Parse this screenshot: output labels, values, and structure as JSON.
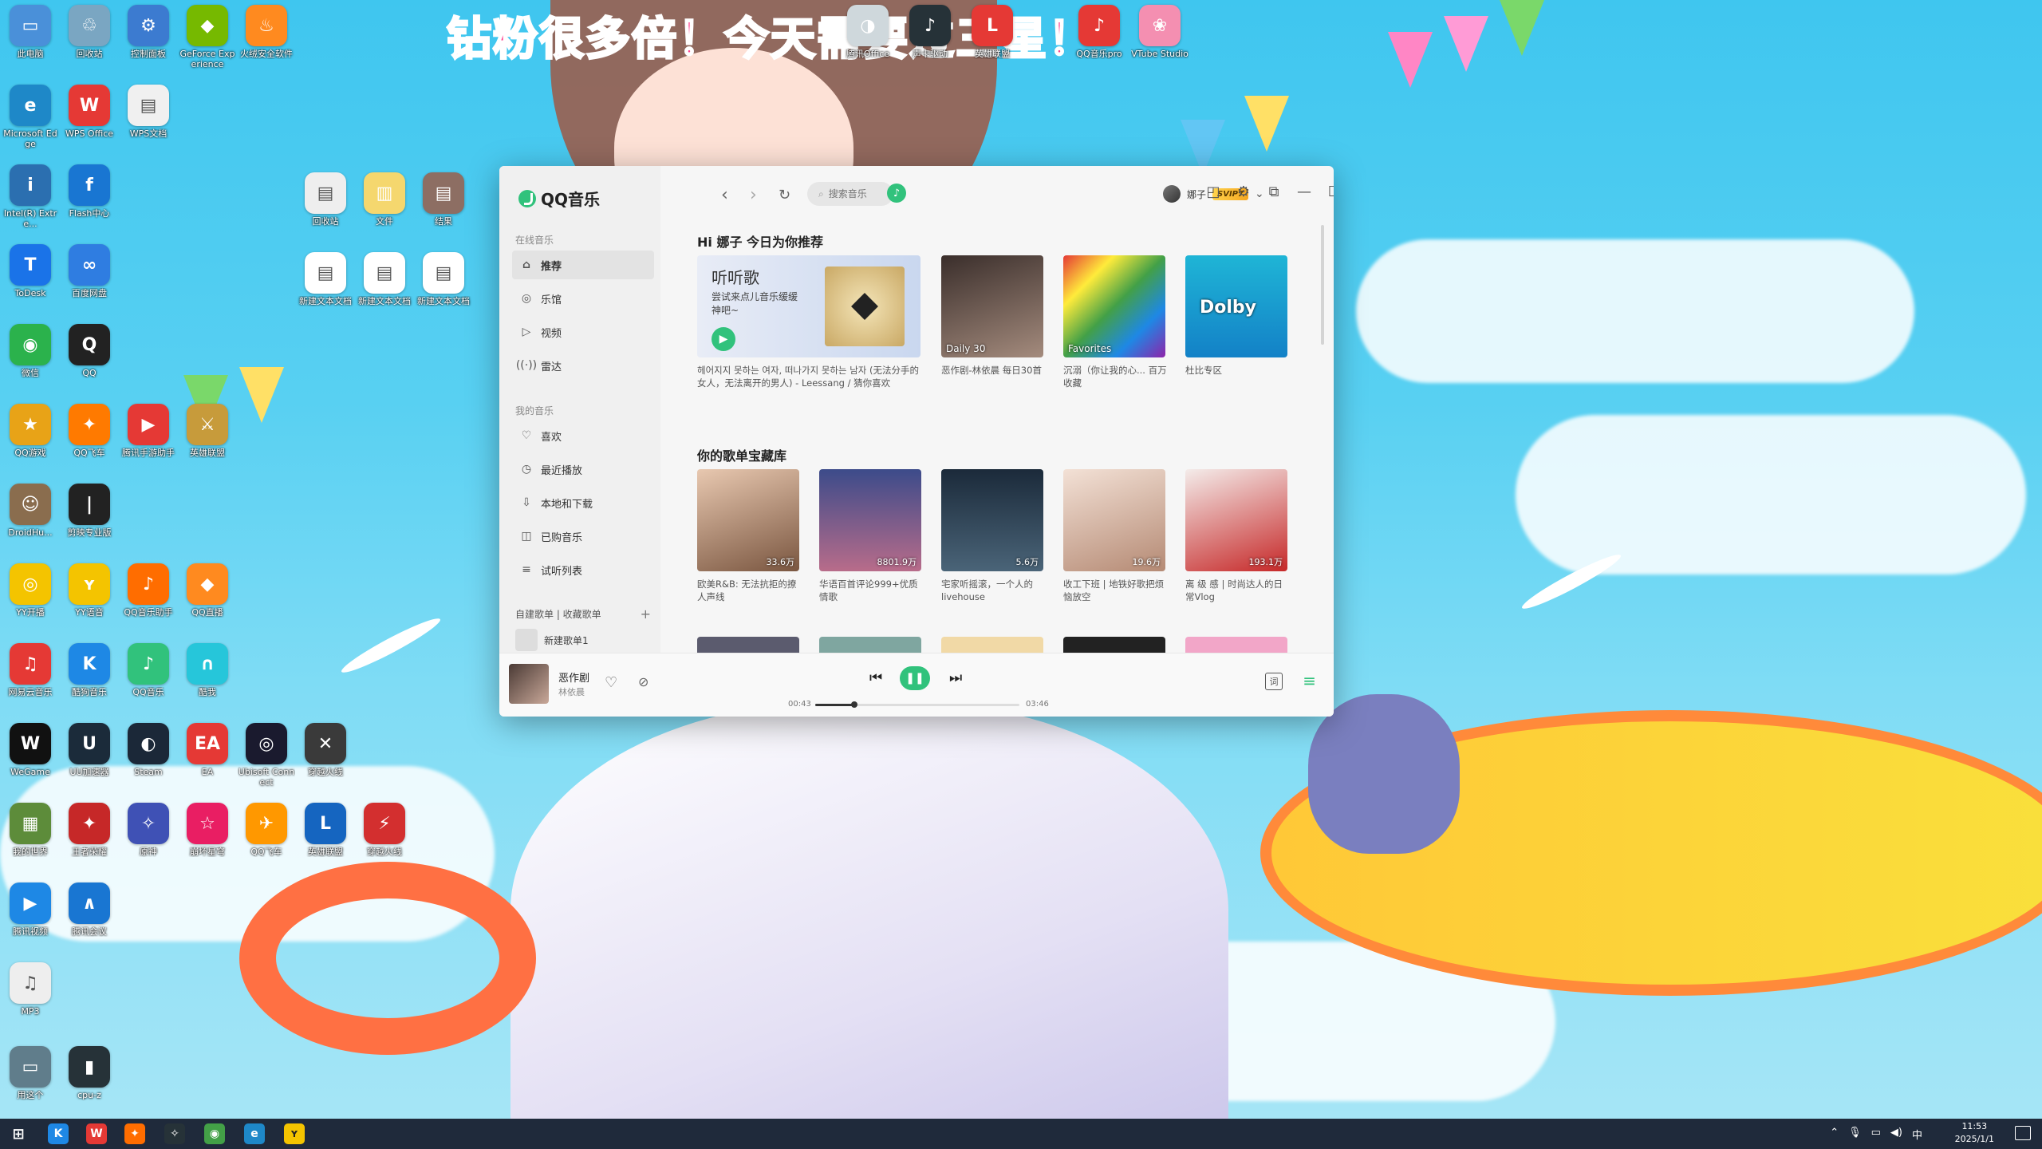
{
  "wallpaper": {
    "banner": "钻粉很多倍！今天需要过三星！"
  },
  "desktop_icons": [
    {
      "label": "此电脑",
      "color": "#4a90d9",
      "glyph": "▭"
    },
    {
      "label": "回收站",
      "color": "#7aa6c2",
      "glyph": "♲"
    },
    {
      "label": "控制面板",
      "color": "#3c7bd0",
      "glyph": "⚙"
    },
    {
      "label": "GeForce Experience",
      "color": "#76b900",
      "glyph": "◆"
    },
    {
      "label": "火绒安全软件",
      "color": "#ff8a1f",
      "glyph": "♨"
    },
    {
      "label": "Microsoft Edge",
      "color": "#1e88c8",
      "glyph": "e"
    },
    {
      "label": "WPS Office",
      "color": "#e53935",
      "glyph": "W"
    },
    {
      "label": "WPS文档",
      "color": "#f0f0f0",
      "glyph": "▤"
    },
    {
      "label": "Intel(R) Extre...",
      "color": "#2b6fb0",
      "glyph": "i"
    },
    {
      "label": "Flash中心",
      "color": "#1976d2",
      "glyph": "f"
    },
    {
      "label": "ToDesk",
      "color": "#1a73e8",
      "glyph": "T"
    },
    {
      "label": "百度网盘",
      "color": "#2f7de1",
      "glyph": "∞"
    },
    {
      "label": "微信",
      "color": "#2bb24c",
      "glyph": "◉"
    },
    {
      "label": "QQ",
      "color": "#222222",
      "glyph": "Q"
    },
    {
      "label": "QQ游戏",
      "color": "#e8a317",
      "glyph": "★"
    },
    {
      "label": "QQ飞车",
      "color": "#ff7a00",
      "glyph": "✦"
    },
    {
      "label": "腾讯手游助手",
      "color": "#e53935",
      "glyph": "▶"
    },
    {
      "label": "英雄联盟",
      "color": "#c79b3b",
      "glyph": "⚔"
    },
    {
      "label": "DroidHu...",
      "color": "#8a6d4e",
      "glyph": "☺"
    },
    {
      "label": "剪映专业版",
      "color": "#222222",
      "glyph": "|"
    },
    {
      "label": "YY开播",
      "color": "#f4c400",
      "glyph": "◎"
    },
    {
      "label": "YY语音",
      "color": "#f4c400",
      "glyph": "ʏ"
    },
    {
      "label": "QQ音乐助手",
      "color": "#ff6d00",
      "glyph": "♪"
    },
    {
      "label": "QQ直播",
      "color": "#ff8a1f",
      "glyph": "◆"
    },
    {
      "label": "网易云音乐",
      "color": "#e53935",
      "glyph": "♫"
    },
    {
      "label": "酷狗音乐",
      "color": "#1e88e5",
      "glyph": "K"
    },
    {
      "label": "QQ音乐",
      "color": "#31c27c",
      "glyph": "♪"
    },
    {
      "label": "酷我",
      "color": "#26c6da",
      "glyph": "∩"
    },
    {
      "label": "WeGame",
      "color": "#111111",
      "glyph": "W"
    },
    {
      "label": "UU加速器",
      "color": "#1b2b3a",
      "glyph": "U"
    },
    {
      "label": "Steam",
      "color": "#1b2838",
      "glyph": "◐"
    },
    {
      "label": "EA",
      "color": "#e53935",
      "glyph": "EA"
    },
    {
      "label": "Ubisoft Connect",
      "color": "#1a1a2e",
      "glyph": "◎"
    },
    {
      "label": "穿越火线",
      "color": "#3a3a3a",
      "glyph": "✕"
    },
    {
      "label": "我的世界",
      "color": "#5d8c3a",
      "glyph": "▦"
    },
    {
      "label": "王者荣耀",
      "color": "#c62828",
      "glyph": "✦"
    },
    {
      "label": "原神",
      "color": "#3f51b5",
      "glyph": "✧"
    },
    {
      "label": "崩坏星穹",
      "color": "#e91e63",
      "glyph": "☆"
    },
    {
      "label": "QQ飞车",
      "color": "#ff9800",
      "glyph": "✈"
    },
    {
      "label": "英雄联盟",
      "color": "#1565c0",
      "glyph": "L"
    },
    {
      "label": "穿越火线",
      "color": "#d32f2f",
      "glyph": "⚡"
    },
    {
      "label": "腾讯视频",
      "color": "#1e88e5",
      "glyph": "▶"
    },
    {
      "label": "腾讯会议",
      "color": "#1976d2",
      "glyph": "∧"
    },
    {
      "label": "MP3",
      "color": "#eeeeee",
      "glyph": "♫"
    },
    {
      "label": "用这个",
      "color": "#607d8b",
      "glyph": "▭"
    },
    {
      "label": "cpu-z",
      "color": "#263238",
      "glyph": "▮"
    },
    {
      "label": "回收站",
      "color": "#eeeeee",
      "glyph": "▤"
    },
    {
      "label": "文件",
      "color": "#f5d76e",
      "glyph": "▥"
    },
    {
      "label": "结果",
      "color": "#8d6e63",
      "glyph": "▤"
    },
    {
      "label": "新建文本文档",
      "color": "#ffffff",
      "glyph": "▤"
    },
    {
      "label": "新建文本文档",
      "color": "#ffffff",
      "glyph": "▤"
    },
    {
      "label": "新建文本文档",
      "color": "#ffffff",
      "glyph": "▤"
    },
    {
      "label": "腾讯Office",
      "color": "#cfd8dc",
      "glyph": "◑"
    },
    {
      "label": "声卡驱动",
      "color": "#263238",
      "glyph": "♪"
    },
    {
      "label": "英雄联盟",
      "color": "#e53935",
      "glyph": "L"
    },
    {
      "label": "QQ音乐pro",
      "color": "#e53935",
      "glyph": "♪"
    },
    {
      "label": "VTube Studio",
      "color": "#f48fb1",
      "glyph": "❀"
    }
  ],
  "app": {
    "name": "QQ音乐",
    "sidebar": {
      "online_title": "在线音乐",
      "online_items": [
        {
          "label": "推荐",
          "icon": "home-icon",
          "glyph": "⌂",
          "active": true
        },
        {
          "label": "乐馆",
          "icon": "disc-icon",
          "glyph": "◎"
        },
        {
          "label": "视频",
          "icon": "video-icon",
          "glyph": "▷"
        },
        {
          "label": "雷达",
          "icon": "radar-icon",
          "glyph": "((·))"
        }
      ],
      "my_title": "我的音乐",
      "my_items": [
        {
          "label": "喜欢",
          "icon": "heart-icon",
          "glyph": "♡"
        },
        {
          "label": "最近播放",
          "icon": "clock-icon",
          "glyph": "◷"
        },
        {
          "label": "本地和下载",
          "icon": "download-icon",
          "glyph": "⇩"
        },
        {
          "label": "已购音乐",
          "icon": "bag-icon",
          "glyph": "◫"
        },
        {
          "label": "试听列表",
          "icon": "list-icon",
          "glyph": "≡"
        }
      ],
      "playlist_tabs": "自建歌单 | 收藏歌单",
      "new_playlist": "新建歌单1"
    },
    "topbar": {
      "search_placeholder": "搜索音乐",
      "user_name": "娜子",
      "vip_badge": "SVIP7"
    },
    "recommend": {
      "heading": "Hi 娜子 今日为你推荐",
      "feature": {
        "title": "听听歌",
        "subtitle": "尝试来点儿音乐缓缓神吧~",
        "desc": "헤어지지 못하는 여자, 떠나가지 못하는 남자 (无法分手的女人，无法离开的男人) - Leessang / 猜你喜欢"
      },
      "cards": [
        {
          "caption": "Daily 30",
          "title": "恶作剧-林依晨 每日30首",
          "bg": "linear-gradient(160deg,#3a2e2b,#a48b7d)"
        },
        {
          "caption": "Favorites",
          "title": "沉溺（你让我的心... 百万收藏",
          "bg": "linear-gradient(135deg,#e53935,#ffeb3b,#43a047,#1e88e5,#8e24aa)"
        },
        {
          "caption": "Dolby",
          "title": "杜比专区",
          "bg": "linear-gradient(180deg,#1fb5d6,#1381c7)"
        }
      ]
    },
    "library": {
      "heading": "你的歌单宝藏库",
      "cards": [
        {
          "count": "33.6万",
          "title": "欧美R&B: 无法抗拒的撩人声线",
          "bg": "linear-gradient(160deg,#e8c8b0,#7a5640)"
        },
        {
          "count": "8801.9万",
          "title": "华语百首评论999+优质情歌",
          "bg": "linear-gradient(180deg,#3c4b8a,#b86c8a)"
        },
        {
          "count": "5.6万",
          "title": "宅家听摇滚，一个人的livehouse",
          "bg": "linear-gradient(180deg,#1b2a3a,#4a6478)"
        },
        {
          "count": "19.6万",
          "title": "收工下班 | 地铁好歌把烦恼放空",
          "bg": "linear-gradient(160deg,#f3e1d6,#b58a74)"
        },
        {
          "count": "193.1万",
          "title": "离 级 感 | 时尚达人的日常Vlog",
          "bg": "linear-gradient(160deg,#f4ecea,#c62828)"
        }
      ]
    },
    "player": {
      "song": "恶作剧",
      "artist": "林依晨",
      "elapsed": "00:43",
      "duration": "03:46",
      "progress": 0.19,
      "lyrics_label": "词"
    }
  },
  "taskbar": {
    "time": "11:53",
    "date": "2025/1/1",
    "ime": "中"
  }
}
